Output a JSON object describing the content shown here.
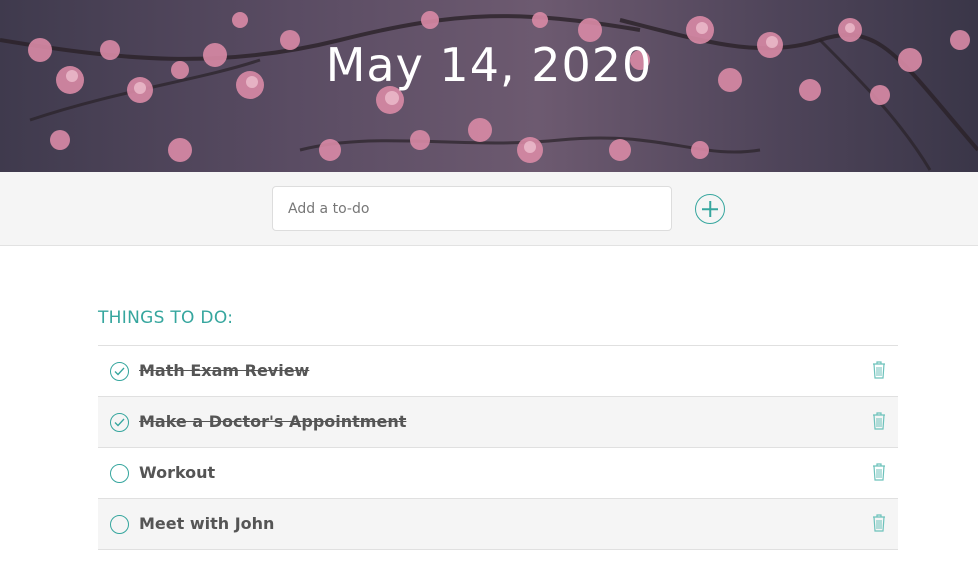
{
  "header": {
    "date": "May 14, 2020"
  },
  "add_bar": {
    "placeholder": "Add a to-do",
    "add_icon": "plus-circle-icon"
  },
  "list": {
    "title": "THINGS TO DO:",
    "check_icon": "check-circle-icon",
    "delete_icon": "trash-icon",
    "items": [
      {
        "text": "Math Exam Review",
        "done": true
      },
      {
        "text": "Make a Doctor's Appointment",
        "done": true
      },
      {
        "text": "Workout",
        "done": false
      },
      {
        "text": "Meet with John",
        "done": false
      }
    ]
  },
  "colors": {
    "accent": "#36a69e",
    "text": "#555555",
    "row_alt": "#f5f5f5"
  }
}
